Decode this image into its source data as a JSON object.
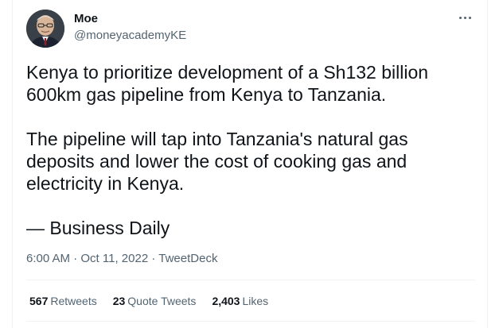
{
  "author": {
    "display_name": "Moe",
    "handle": "@moneyacademyKE"
  },
  "tweet": {
    "paragraphs": [
      "Kenya to prioritize development of a Sh132 billion 600km gas pipeline from Kenya to Tanzania.",
      "The pipeline will tap into Tanzania's natural gas deposits and lower the cost of cooking gas and electricity in Kenya.",
      "— Business Daily"
    ],
    "time": "6:00 AM",
    "date": "Oct 11, 2022",
    "source": "TweetDeck",
    "separator": "·"
  },
  "stats": {
    "retweets_count": "567",
    "retweets_label": "Retweets",
    "quotes_count": "23",
    "quotes_label": "Quote Tweets",
    "likes_count": "2,403",
    "likes_label": "Likes"
  },
  "icons": {
    "more": "more-options-icon"
  },
  "colors": {
    "text_primary": "#0f1419",
    "text_secondary": "#536471",
    "divider": "#eff3f4"
  }
}
